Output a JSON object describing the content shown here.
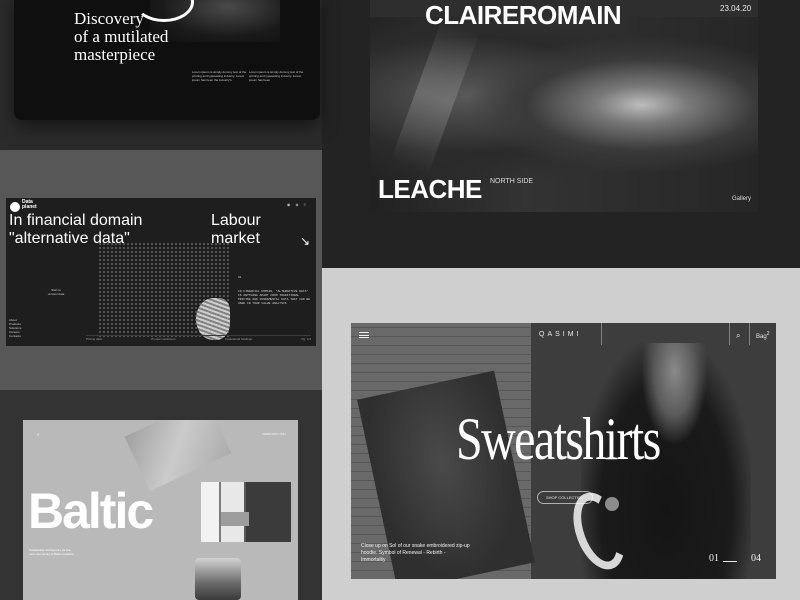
{
  "discovery": {
    "title_lines": [
      "Discovery",
      "of a mutilated",
      "masterpiece"
    ],
    "blurb_a": "Lorem ipsum is simply dummy text of the printing and typesetting industry. Lorem ipsum has been the industry's",
    "blurb_b": "Lorem ipsum is simply dummy text of the printing and typesetting industry. Lorem ipsum has been"
  },
  "claire": {
    "headline": "CLAIREROMAIN",
    "date": "23.04.20",
    "subtitle": "LEACHE",
    "tag": "NORTH SIDE",
    "gallery": "Gallery"
  },
  "data_planet": {
    "brand_line1": "Data",
    "brand_line2": "planet",
    "heading_lines": [
      "In financial domain",
      "\"alternative data\""
    ],
    "heading2_lines": [
      "Labour",
      "market"
    ],
    "arrow": "↘",
    "start_label": "Start to unravel data",
    "index": "01",
    "mono_text": "IN FINANCIAL DOMAIN, \"ALTERNATIVE DATA\" IS ANYTHING APART FROM TRADITIONAL PRICING AND FUNDAMENTAL DATA THAT CAN BE USED IN YOUR VALUE ANALYSIS",
    "nav_items": [
      "About",
      "Products",
      "Solutions",
      "Careers",
      "Contacts"
    ],
    "footer_items": [
      "Pricing data",
      "Product sentiment",
      "Institutional holdings",
      "Pg. 1/4"
    ]
  },
  "baltic": {
    "word": "Baltic",
    "date": "FEBRUARY 2021",
    "menu_icon": "menu-icon",
    "foot_text": "Sustainable architecture for the new community of Baltic coastline"
  },
  "sweatshirts": {
    "logo": "QASIMI",
    "bag": "Bag",
    "bag_count": "2",
    "headline": "Sweatshirts",
    "shop_label": "SHOP COLLECTION",
    "caption": "Close up on Sol of our snake embroidered zip-up hoodie. Symbol of Renewal - Rebirth - Immortality",
    "pager_current": "01",
    "pager_total": "04"
  }
}
